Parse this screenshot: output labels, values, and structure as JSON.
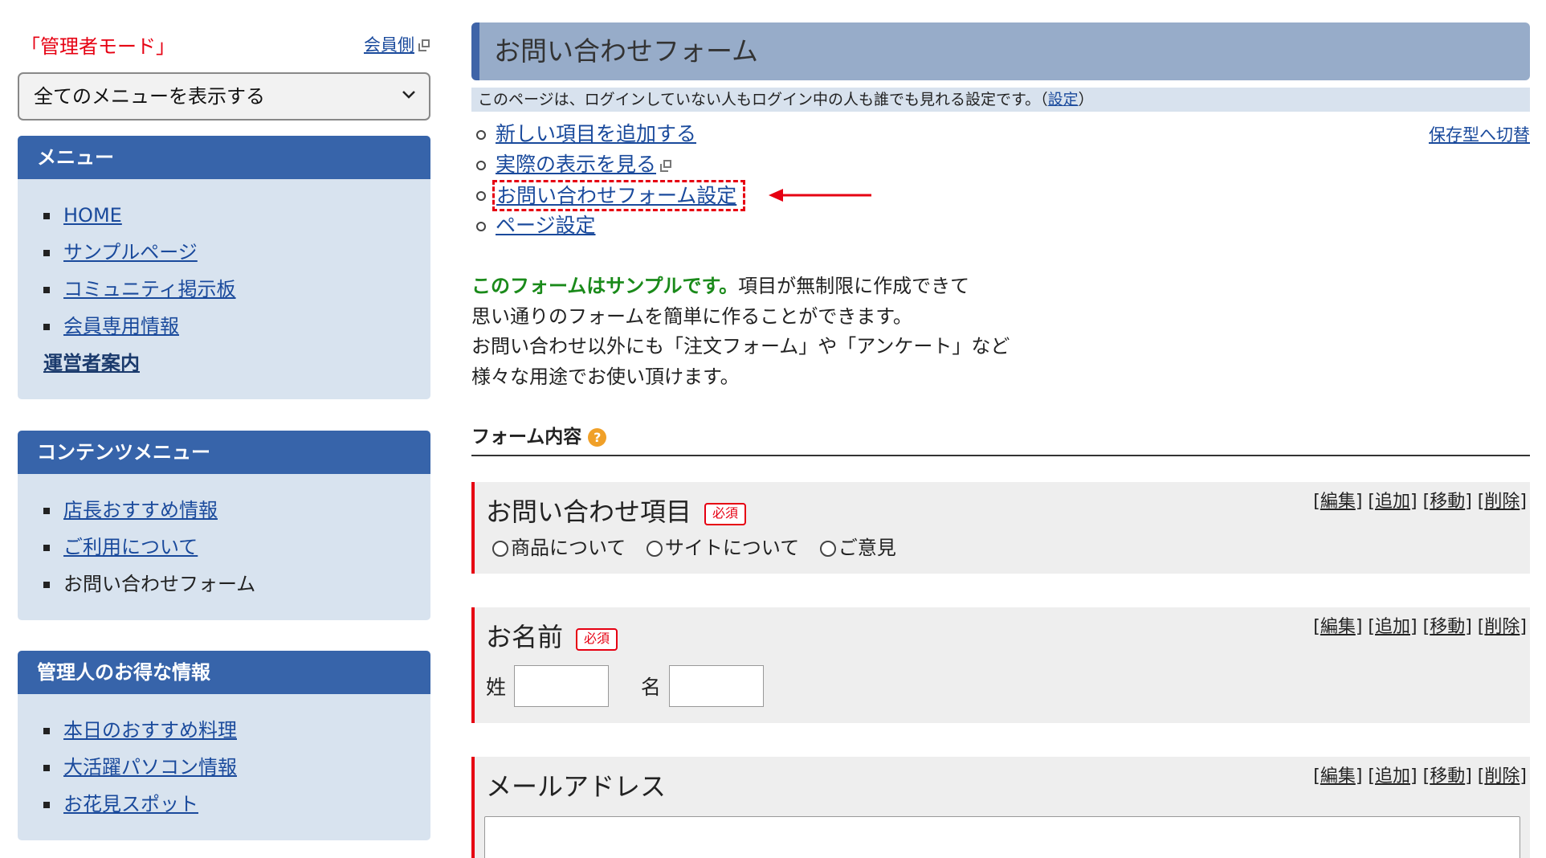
{
  "sidebar": {
    "admin_mode": "「管理者モード」",
    "member_side": "会員側",
    "menu_select": "全てのメニューを表示する",
    "menu": {
      "title": "メニュー",
      "items": [
        {
          "label": "HOME"
        },
        {
          "label": "サンプルページ"
        },
        {
          "label": "コミュニティ掲示板"
        },
        {
          "label": "会員専用情報"
        }
      ],
      "sub_link": "運営者案内"
    },
    "contents_menu": {
      "title": "コンテンツメニュー",
      "items": [
        {
          "label": "店長おすすめ情報"
        },
        {
          "label": "ご利用について"
        },
        {
          "label": "お問い合わせフォーム"
        }
      ]
    },
    "owner_menu": {
      "title": "管理人のお得な情報",
      "items": [
        {
          "label": "本日のおすすめ料理"
        },
        {
          "label": "大活躍パソコン情報"
        },
        {
          "label": "お花見スポット"
        }
      ]
    }
  },
  "main": {
    "title": "お問い合わせフォーム",
    "notice_text": "このページは、ログインしていない人もログイン中の人も誰でも見れる設定です。（",
    "notice_link": "設定",
    "notice_close": "）",
    "switch_link": "保存型へ切替",
    "actions": [
      {
        "label": "新しい項目を追加する"
      },
      {
        "label": "実際の表示を見る"
      },
      {
        "label": "お問い合わせフォーム設定"
      },
      {
        "label": "ページ設定"
      }
    ],
    "desc": {
      "lead": "このフォームはサンプルです。",
      "line1": "項目が無制限に作成できて",
      "line2": "思い通りのフォームを簡単に作ることができます。",
      "line3": "お問い合わせ以外にも「注文フォーム」や「アンケート」など",
      "line4": "様々な用途でお使い頂けます。"
    },
    "section_title": "フォーム内容",
    "help_icon": "?",
    "required_label": "必須",
    "controls": {
      "edit": "編集",
      "add": "追加",
      "move": "移動",
      "delete": "削除"
    },
    "fields": {
      "inquiry": {
        "label": "お問い合わせ項目",
        "options": [
          "商品について",
          "サイトについて",
          "ご意見"
        ]
      },
      "name": {
        "label": "お名前",
        "last": "姓",
        "first": "名"
      },
      "email": {
        "label": "メールアドレス"
      }
    }
  },
  "colors": {
    "admin_red": "#e60012",
    "menu_header": "#3764aa",
    "menu_bg": "#d8e3ef",
    "title_bar": "#97acc9",
    "title_bar_accent": "#3f64a8",
    "link": "#1a4a9c",
    "lead_green": "#1a8a1a",
    "help_orange": "#f0a028"
  },
  "icons": {
    "external": "external-link-icon",
    "chevron": "chevron-down-icon",
    "arrow": "arrow-left-icon",
    "help": "help-icon"
  }
}
